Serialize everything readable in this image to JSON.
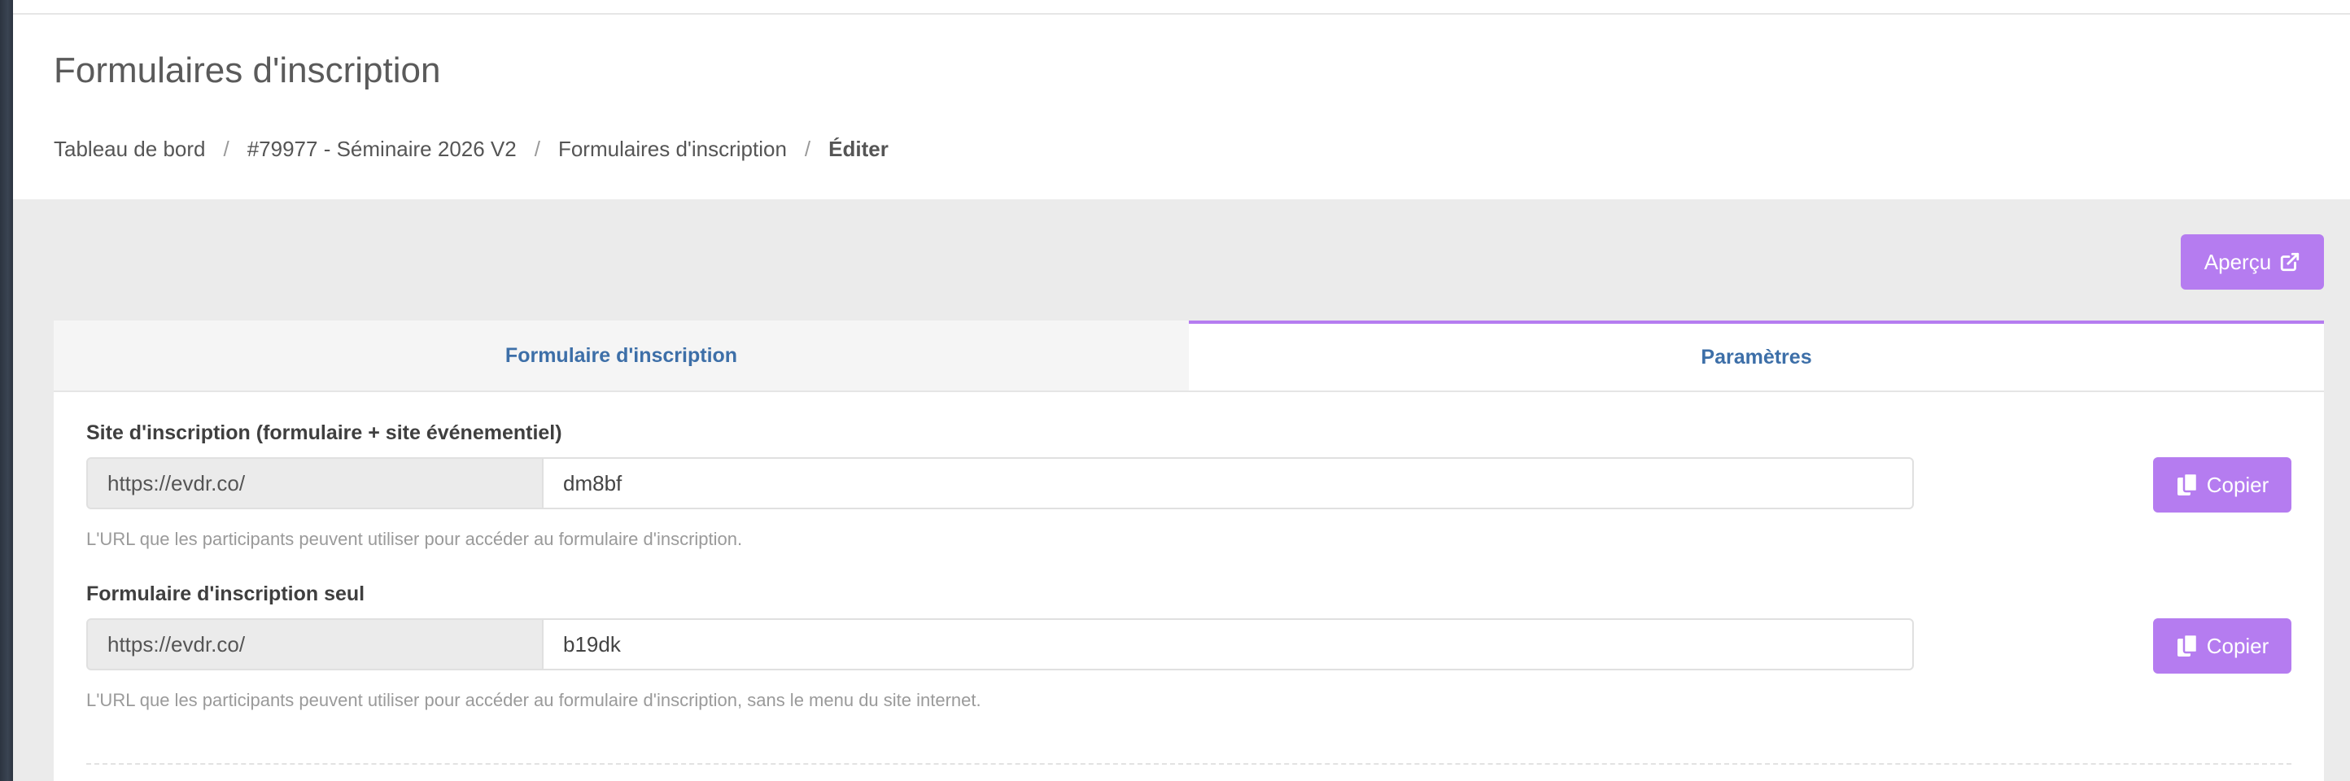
{
  "header": {
    "title": "Formulaires d'inscription",
    "breadcrumb": [
      {
        "label": "Tableau de bord"
      },
      {
        "label": "#79977 - Séminaire 2026 V2"
      },
      {
        "label": "Formulaires d'inscription"
      },
      {
        "label": "Éditer"
      }
    ],
    "separator": "/"
  },
  "toolbar": {
    "preview_label": "Aperçu",
    "preview_icon": "external-link-icon"
  },
  "tabs": [
    {
      "label": "Formulaire d'inscription",
      "active": false
    },
    {
      "label": "Paramètres",
      "active": true
    }
  ],
  "fields": [
    {
      "label": "Site d'inscription (formulaire + site événementiel)",
      "prefix": "https://evdr.co/",
      "value": "dm8bf",
      "copy_label": "Copier",
      "help": "L'URL que les participants peuvent utiliser pour accéder au formulaire d'inscription."
    },
    {
      "label": "Formulaire d'inscription seul",
      "prefix": "https://evdr.co/",
      "value": "b19dk",
      "copy_label": "Copier",
      "help": "L'URL que les participants peuvent utiliser pour accéder au formulaire d'inscription, sans le menu du site internet."
    }
  ],
  "colors": {
    "accent": "#b57cf0",
    "tab_text": "#3d6fa8",
    "background": "#ebebeb"
  }
}
